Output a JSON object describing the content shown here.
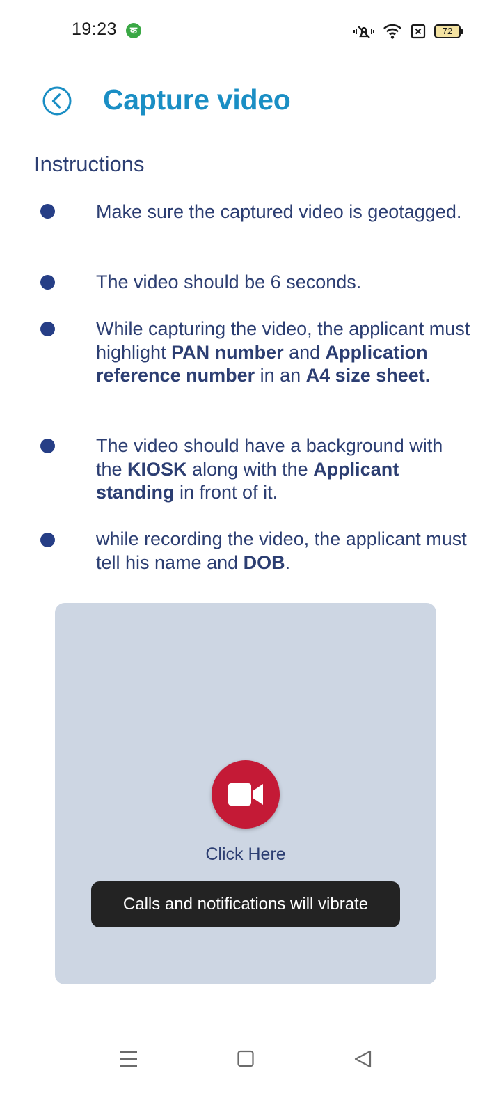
{
  "status_bar": {
    "time": "19:23",
    "app_badge": "क",
    "battery": "72"
  },
  "header": {
    "title": "Capture video"
  },
  "instructions": {
    "heading": "Instructions",
    "items": [
      {
        "parts": [
          {
            "text": "Make sure the captured video is geotagged.",
            "bold": false
          }
        ]
      },
      {
        "parts": [
          {
            "text": "The video should be 6 seconds.",
            "bold": false
          }
        ]
      },
      {
        "parts": [
          {
            "text": "While capturing the video, the applicant must highlight ",
            "bold": false
          },
          {
            "text": "PAN number",
            "bold": true
          },
          {
            "text": " and ",
            "bold": false
          },
          {
            "text": "Application reference number",
            "bold": true
          },
          {
            "text": " in an ",
            "bold": false
          },
          {
            "text": "A4 size sheet.",
            "bold": true
          }
        ]
      },
      {
        "parts": [
          {
            "text": " The video should have a background with the ",
            "bold": false
          },
          {
            "text": "KIOSK",
            "bold": true
          },
          {
            "text": " along with the ",
            "bold": false
          },
          {
            "text": "Applicant standing",
            "bold": true
          },
          {
            "text": " in front of it.",
            "bold": false
          }
        ]
      },
      {
        "parts": [
          {
            "text": "while recording the video, the applicant must tell his name and ",
            "bold": false
          },
          {
            "text": "DOB",
            "bold": true
          },
          {
            "text": ".",
            "bold": false
          }
        ]
      }
    ]
  },
  "capture": {
    "button_icon": "video-camera-icon",
    "label": "Click Here"
  },
  "toast": {
    "message": "Calls and notifications will vibrate"
  },
  "nav": {
    "menu_icon": "menu-icon",
    "home_icon": "home-square-icon",
    "back_icon": "back-triangle-icon"
  },
  "colors": {
    "title": "#1a8ec4",
    "text": "#2c3e72",
    "bullet": "#263e86",
    "panel": "#cdd6e3",
    "record": "#c41a36",
    "toast": "#232323"
  }
}
